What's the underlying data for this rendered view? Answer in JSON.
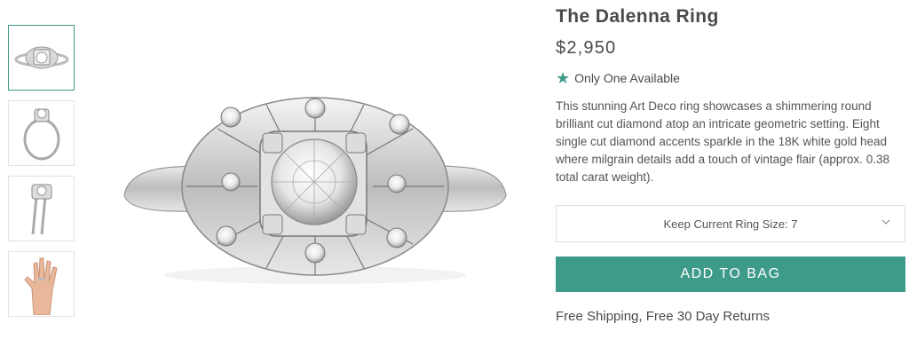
{
  "product": {
    "title": "The Dalenna Ring",
    "price": "$2,950",
    "availability": "Only One Available",
    "description": "This stunning Art Deco ring showcases a shimmering round brilliant cut diamond atop an intricate geometric setting. Eight single cut diamond accents sparkle in the 18K white gold head where milgrain details add a touch of vintage flair (approx. 0.38 total carat weight).",
    "size_select": "Keep Current Ring Size: 7",
    "add_to_bag": "ADD TO BAG",
    "shipping": "Free Shipping, Free 30 Day Returns"
  },
  "gallery": {
    "thumbnails": [
      "top-view",
      "side-view",
      "angled-view",
      "on-hand-view"
    ],
    "active_index": 0
  },
  "colors": {
    "accent": "#3f9b89",
    "border": "#dddddd",
    "text": "#4a4a4a"
  }
}
